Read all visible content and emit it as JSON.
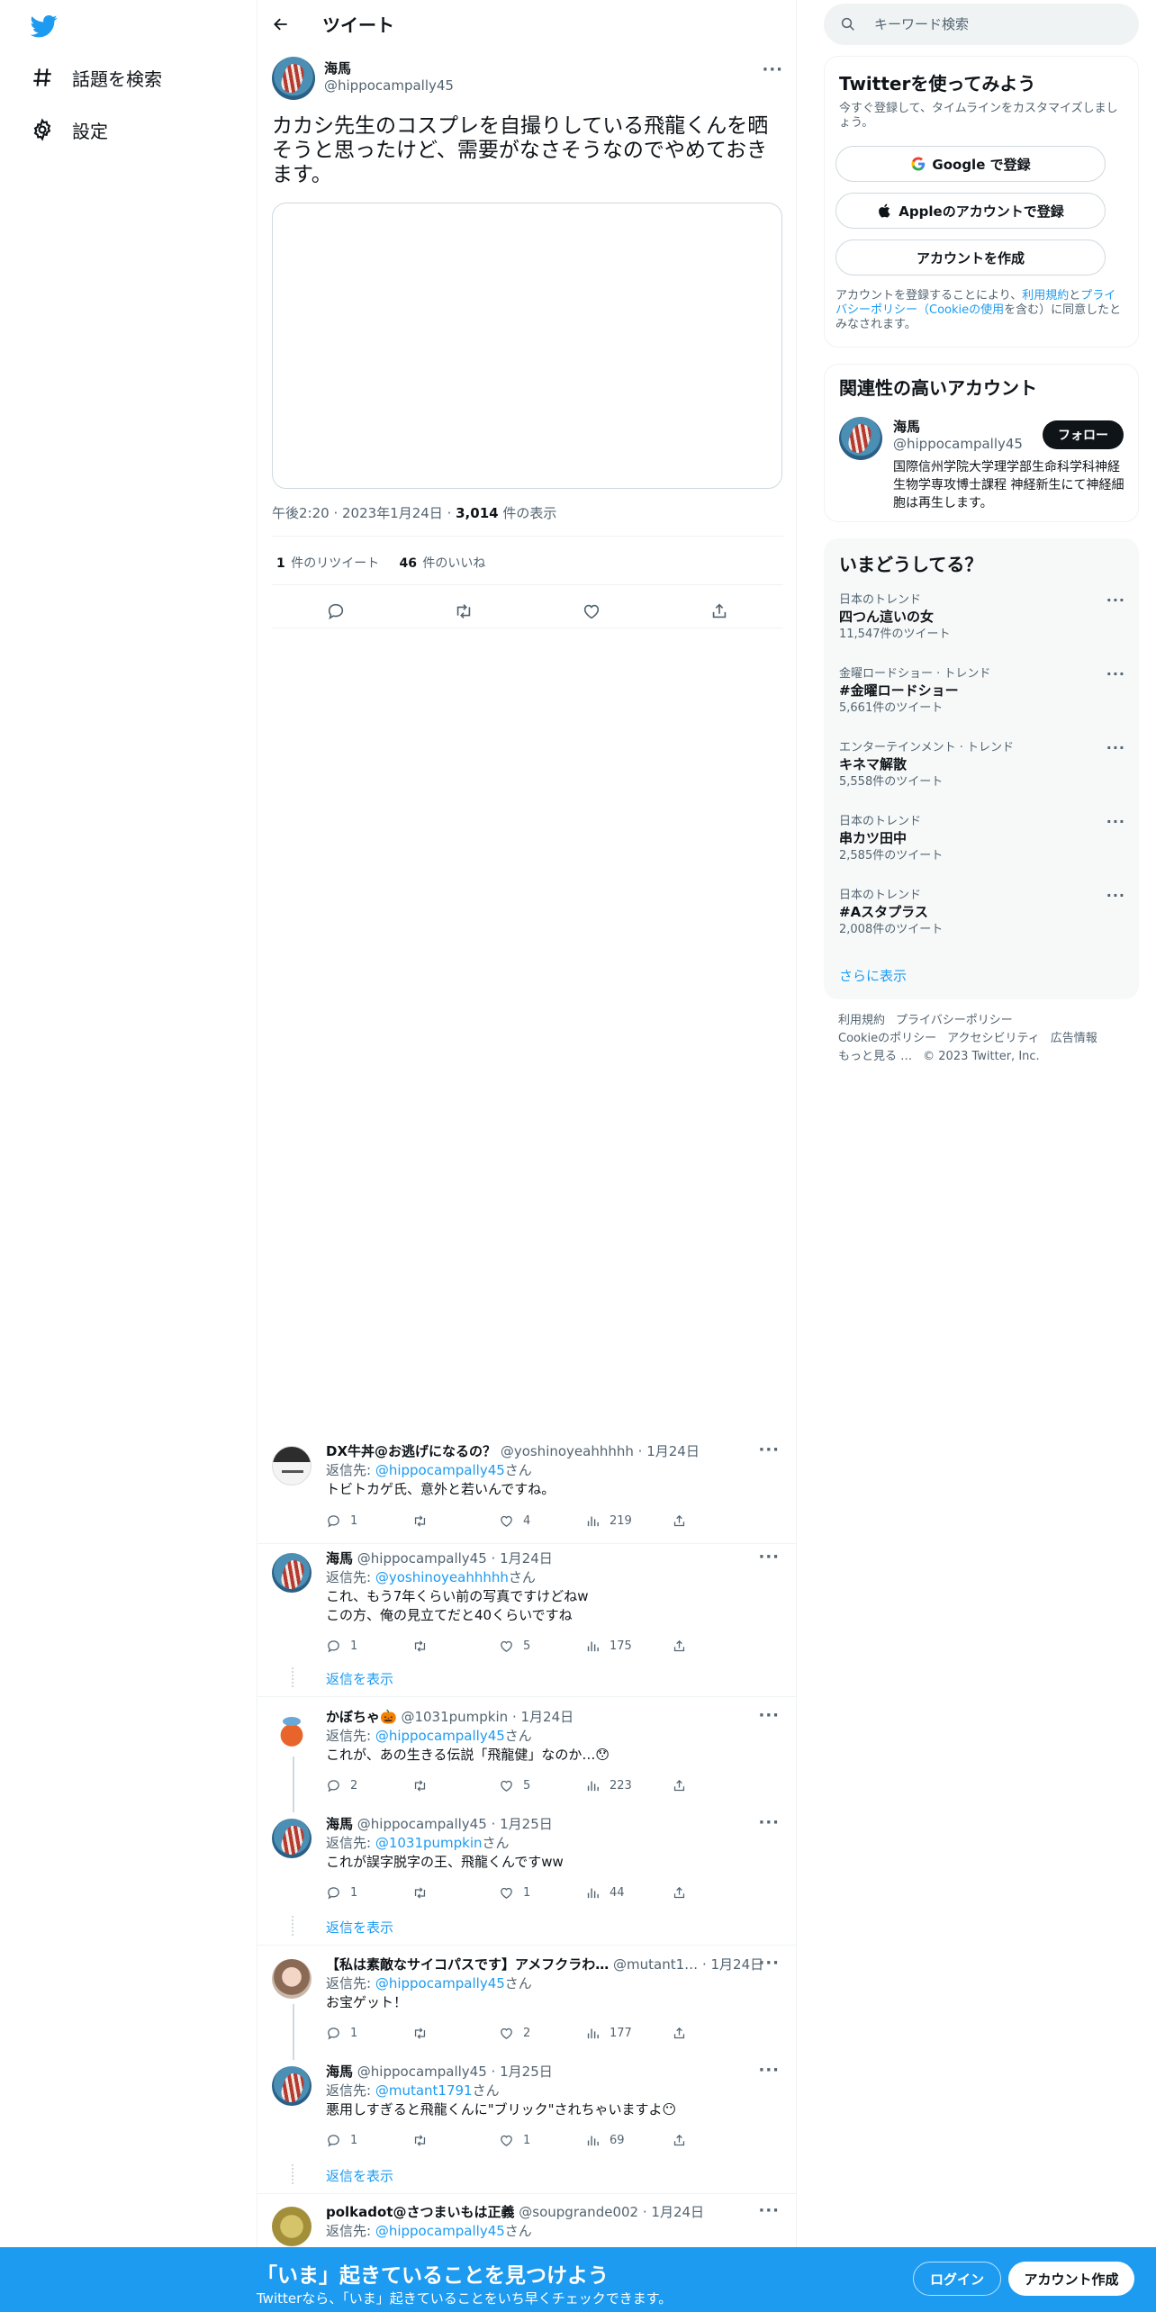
{
  "nav": {
    "items": [
      {
        "label": "話題を検索",
        "icon": "hashtag-icon"
      },
      {
        "label": "設定",
        "icon": "gear-icon"
      }
    ]
  },
  "header": {
    "title": "ツイート"
  },
  "tweet": {
    "author_name": "海馬",
    "author_handle": "@hippocampally45",
    "text": "カカシ先生のコスプレを自撮りしている飛龍くんを晒そうと思ったけど、需要がなさそうなのでやめておきます。",
    "time": "午後2:20",
    "date": "2023年1月24日",
    "views_count": "3,014",
    "views_label": "件の表示",
    "retweets_count": "1",
    "retweets_label": "件のリツイート",
    "likes_count": "46",
    "likes_label": "件のいいね"
  },
  "replies": [
    {
      "name": "DX牛丼@お逃げになるの？",
      "handle": "@yoshinoyeahhhhh",
      "date": "1月24日",
      "reply_to_label": "返信先: ",
      "reply_to": "@hippocampally45",
      "reply_to_suffix": "さん",
      "text": "トビトカゲ氏、意外と若いんですね。",
      "text2": "",
      "replies": "1",
      "retweets": "",
      "likes": "4",
      "views": "219"
    },
    {
      "name": "海馬",
      "handle": "@hippocampally45",
      "date": "1月24日",
      "reply_to_label": "返信先: ",
      "reply_to": "@yoshinoyeahhhhh",
      "reply_to_suffix": "さん",
      "text": "これ、もう7年くらい前の写真ですけどねw",
      "text2": "この方、俺の見立てだと40くらいですね",
      "replies": "1",
      "retweets": "",
      "likes": "5",
      "views": "175"
    },
    {
      "name": "かぼちゃ🎃",
      "handle": "@1031pumpkin",
      "date": "1月24日",
      "reply_to_label": "返信先: ",
      "reply_to": "@hippocampally45",
      "reply_to_suffix": "さん",
      "text": "これが、あの生きる伝説「飛龍健」なのか…😯",
      "text2": "",
      "replies": "2",
      "retweets": "",
      "likes": "5",
      "views": "223"
    },
    {
      "name": "海馬",
      "handle": "@hippocampally45",
      "date": "1月25日",
      "reply_to_label": "返信先: ",
      "reply_to": "@1031pumpkin",
      "reply_to_suffix": "さん",
      "text": "これが誤字脱字の王、飛龍くんですww",
      "text2": "",
      "replies": "1",
      "retweets": "",
      "likes": "1",
      "views": "44"
    },
    {
      "name": "【私は素敵なサイコパスです】アメフクラわ…",
      "handle": "@mutant1…",
      "date": "1月24日",
      "reply_to_label": "返信先: ",
      "reply_to": "@hippocampally45",
      "reply_to_suffix": "さん",
      "text": "お宝ゲット！",
      "text2": "",
      "replies": "1",
      "retweets": "",
      "likes": "2",
      "views": "177"
    },
    {
      "name": "海馬",
      "handle": "@hippocampally45",
      "date": "1月25日",
      "reply_to_label": "返信先: ",
      "reply_to": "@mutant1791",
      "reply_to_suffix": "さん",
      "text": "悪用しすぎると飛龍くんに\"ブリック\"されちゃいますよ😶",
      "text2": "",
      "replies": "1",
      "retweets": "",
      "likes": "1",
      "views": "69"
    },
    {
      "name": "polkadot@さつまいもは正義",
      "handle": "@soupgrande002",
      "date": "1月24日",
      "reply_to_label": "返信先: ",
      "reply_to": "@hippocampally45",
      "reply_to_suffix": "さん",
      "text": "",
      "text2": "",
      "replies": "",
      "retweets": "",
      "likes": "",
      "views": ""
    }
  ],
  "show_replies_label": "返信を表示",
  "search": {
    "placeholder": "キーワード検索"
  },
  "signup_card": {
    "title": "Twitterを使ってみよう",
    "subtitle": "今すぐ登録して、タイムラインをカスタマイズしましょう。",
    "google": "Google で登録",
    "apple": "Appleのアカウントで登録",
    "create": "アカウントを作成",
    "legal_1": "アカウントを登録することにより、",
    "legal_terms": "利用規約",
    "legal_2": "と",
    "legal_privacy": "プライバシーポリシー（Cookieの使用",
    "legal_3": "を含む）に同意したとみなされます。"
  },
  "related": {
    "title": "関連性の高いアカウント",
    "name": "海馬",
    "handle": "@hippocampally45",
    "follow": "フォロー",
    "bio": "国際信州学院大学理学部生命科学科神経生物学専攻博士課程 神経新生にて神経細胞は再生します。"
  },
  "trends": {
    "title": "いまどうしてる？",
    "items": [
      {
        "context": "日本のトレンド",
        "name": "四つん這いの女",
        "count": "11,547件のツイート"
      },
      {
        "context": "金曜ロードショー · トレンド",
        "name": "#金曜ロードショー",
        "count": "5,661件のツイート"
      },
      {
        "context": "エンターテインメント · トレンド",
        "name": "キネマ解散",
        "count": "5,558件のツイート"
      },
      {
        "context": "日本のトレンド",
        "name": "串カツ田中",
        "count": "2,585件のツイート"
      },
      {
        "context": "日本のトレンド",
        "name": "#Aスタプラス",
        "count": "2,008件のツイート"
      }
    ],
    "show_more": "さらに表示"
  },
  "footer": {
    "terms": "利用規約",
    "privacy": "プライバシーポリシー",
    "cookie": "Cookieのポリシー",
    "accessibility": "アクセシビリティ",
    "ads": "広告情報",
    "more": "もっと見る …",
    "copyright": "© 2023 Twitter, Inc."
  },
  "bottom_bar": {
    "title": "「いま」起きていることを見つけよう",
    "subtitle": "Twitterなら、「いま」起きていることをいち早くチェックできます。",
    "login": "ログイン",
    "signup": "アカウント作成"
  },
  "colors": {
    "accent": "#1d9bf0",
    "text": "#0f1419",
    "muted": "#536471",
    "border": "#eff3f4"
  }
}
